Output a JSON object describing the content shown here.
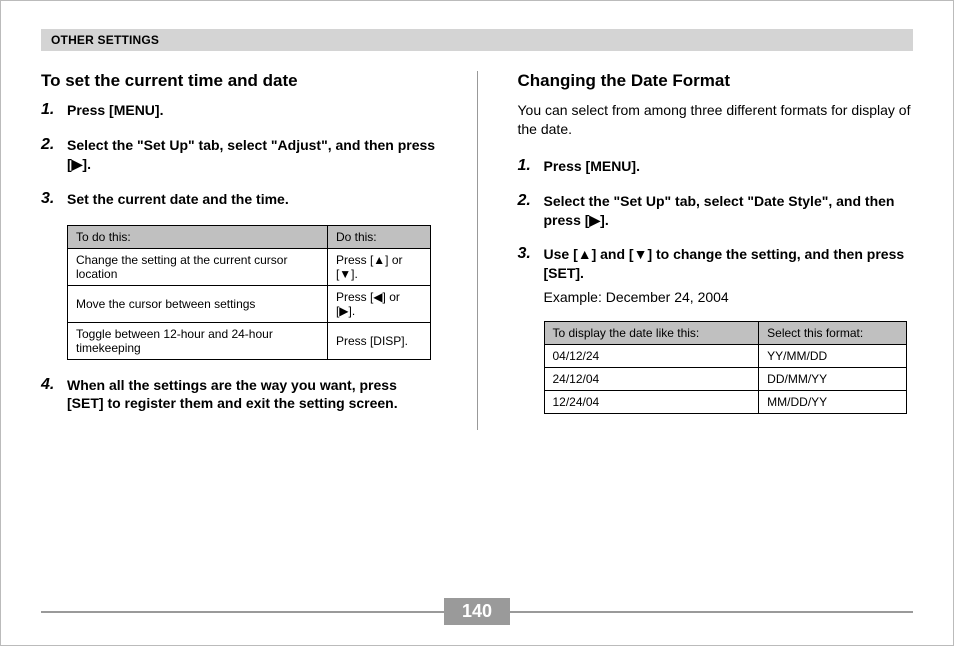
{
  "header": {
    "section": "OTHER SETTINGS"
  },
  "glyphs": {
    "up": "▲",
    "down": "▼",
    "left": "◀",
    "right": "▶"
  },
  "left": {
    "title": "To set the current time and date",
    "steps": [
      {
        "n": "1.",
        "text": "Press [MENU]."
      },
      {
        "n": "2.",
        "text": "Select the \"Set Up\" tab, select \"Adjust\", and then press [▶]."
      },
      {
        "n": "3.",
        "text": "Set the current date and the time."
      },
      {
        "n": "4.",
        "text": "When all the settings are the way you want, press [SET] to register them and exit the setting screen."
      }
    ],
    "table": {
      "head": [
        "To do this:",
        "Do this:"
      ],
      "rows": [
        [
          "Change the setting at the current cursor location",
          "Press [▲] or [▼]."
        ],
        [
          "Move the cursor between settings",
          "Press [◀] or [▶]."
        ],
        [
          "Toggle between 12-hour and 24-hour timekeeping",
          "Press [DISP]."
        ]
      ]
    }
  },
  "right": {
    "title": "Changing the Date Format",
    "intro": "You can select from among three different formats for display of the date.",
    "steps": [
      {
        "n": "1.",
        "text": "Press [MENU]."
      },
      {
        "n": "2.",
        "text": "Select the \"Set Up\" tab, select \"Date Style\", and then press [▶]."
      },
      {
        "n": "3.",
        "text": "Use [▲] and [▼] to change the setting, and then press [SET].",
        "sub": "Example: December 24, 2004"
      }
    ],
    "table": {
      "head": [
        "To display the date like this:",
        "Select this format:"
      ],
      "rows": [
        [
          "04/12/24",
          "YY/MM/DD"
        ],
        [
          "24/12/04",
          "DD/MM/YY"
        ],
        [
          "12/24/04",
          "MM/DD/YY"
        ]
      ]
    }
  },
  "page": "140"
}
